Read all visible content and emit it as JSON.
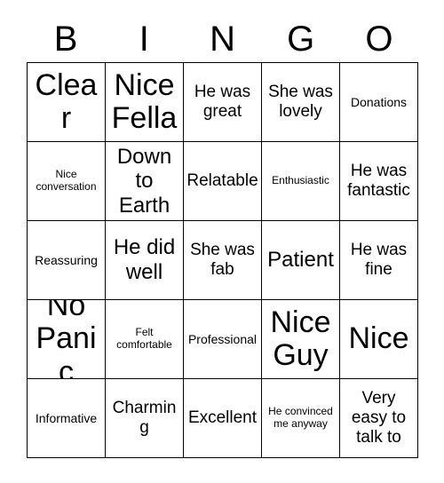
{
  "header": {
    "letters": [
      "B",
      "I",
      "N",
      "G",
      "O"
    ]
  },
  "grid": {
    "rows": 5,
    "columns": 5,
    "border_color": "#000000",
    "cell_background": "#ffffff",
    "text_color": "#000000",
    "cells": [
      {
        "text": "Clear",
        "size": "xxl"
      },
      {
        "text": "Nice Fella",
        "size": "xxl"
      },
      {
        "text": "He was great",
        "size": "md"
      },
      {
        "text": "She was lovely",
        "size": "md"
      },
      {
        "text": "Donations",
        "size": "sm"
      },
      {
        "text": "Nice conversation",
        "size": "xs"
      },
      {
        "text": "Down to Earth",
        "size": "lg"
      },
      {
        "text": "Relatable",
        "size": "md"
      },
      {
        "text": "Enthusiastic",
        "size": "xs"
      },
      {
        "text": "He was fantastic",
        "size": "md"
      },
      {
        "text": "Reassuring",
        "size": "sm"
      },
      {
        "text": "He did well",
        "size": "lg"
      },
      {
        "text": "She was fab",
        "size": "md"
      },
      {
        "text": "Patient",
        "size": "lg"
      },
      {
        "text": "He was fine",
        "size": "md"
      },
      {
        "text": "No Panic",
        "size": "xxl"
      },
      {
        "text": "Felt comfortable",
        "size": "xs"
      },
      {
        "text": "Professional",
        "size": "sm"
      },
      {
        "text": "Nice Guy",
        "size": "xxl"
      },
      {
        "text": "Nice",
        "size": "xxl"
      },
      {
        "text": "Informative",
        "size": "sm"
      },
      {
        "text": "Charming",
        "size": "md"
      },
      {
        "text": "Excellent",
        "size": "md"
      },
      {
        "text": "He convinced me anyway",
        "size": "xs"
      },
      {
        "text": "Very easy to talk to",
        "size": "md"
      }
    ]
  }
}
